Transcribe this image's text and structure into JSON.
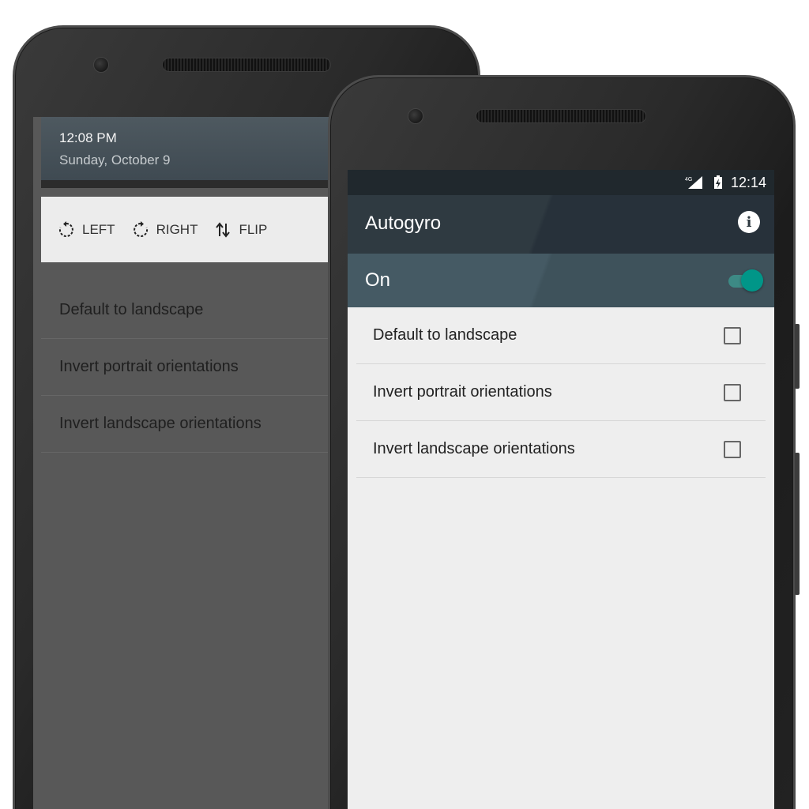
{
  "back_phone": {
    "notification": {
      "time": "12:08 PM",
      "date": "Sunday, October 9"
    },
    "quick_actions": [
      {
        "label": "LEFT",
        "icon": "rotate-left-icon"
      },
      {
        "label": "RIGHT",
        "icon": "rotate-right-icon"
      },
      {
        "label": "FLIP",
        "icon": "flip-icon"
      }
    ],
    "rows": [
      {
        "label": "Default to landscape"
      },
      {
        "label": "Invert portrait orientations"
      },
      {
        "label": "Invert landscape orientations"
      }
    ]
  },
  "front_phone": {
    "status_bar": {
      "network": "4G",
      "time": "12:14"
    },
    "app_bar": {
      "title": "Autogyro",
      "info_icon": "info-icon"
    },
    "master_switch": {
      "label": "On",
      "checked": true
    },
    "preferences": [
      {
        "label": "Default to landscape",
        "checked": false
      },
      {
        "label": "Invert portrait orientations",
        "checked": false
      },
      {
        "label": "Invert landscape orientations",
        "checked": false
      }
    ]
  },
  "colors": {
    "app_bar": "#2f3a41",
    "switch_bar": "#455a64",
    "accent": "#009688",
    "list_background": "#eeeeee"
  }
}
